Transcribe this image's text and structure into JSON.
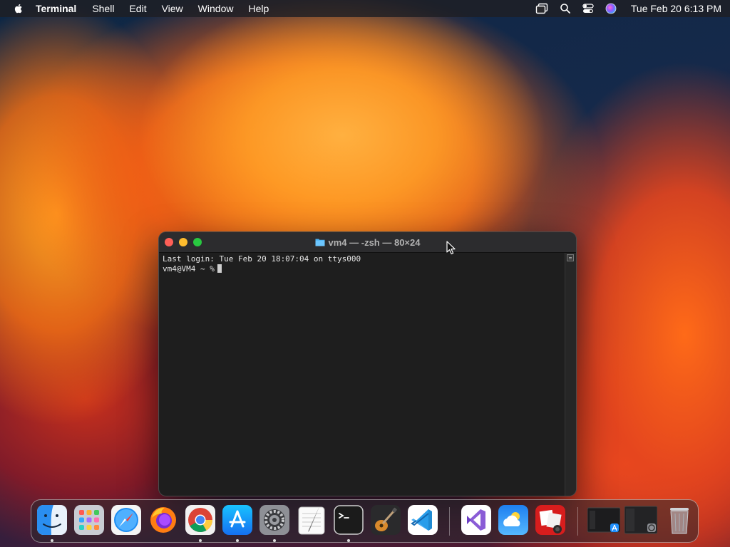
{
  "menubar": {
    "app_name": "Terminal",
    "menus": [
      "Shell",
      "Edit",
      "View",
      "Window",
      "Help"
    ],
    "clock": "Tue Feb 20  6:13 PM",
    "status_icons": [
      "window-stack-icon",
      "search-icon",
      "control-center-icon",
      "siri-icon"
    ]
  },
  "terminal": {
    "title": "vm4 — -zsh — 80×24",
    "lines": [
      "Last login: Tue Feb 20 18:07:04 on ttys000"
    ],
    "prompt": "vm4@VM4 ~ %"
  },
  "dock": {
    "apps": [
      {
        "name": "Finder",
        "icon": "finder-icon",
        "running": true
      },
      {
        "name": "Launchpad",
        "icon": "launchpad-icon",
        "running": false
      },
      {
        "name": "Safari",
        "icon": "safari-icon",
        "running": false
      },
      {
        "name": "Firefox",
        "icon": "firefox-icon",
        "running": false
      },
      {
        "name": "Google Chrome",
        "icon": "chrome-icon",
        "running": true
      },
      {
        "name": "App Store",
        "icon": "app-store-icon",
        "running": true
      },
      {
        "name": "System Settings",
        "icon": "settings-gear-icon",
        "running": true
      },
      {
        "name": "TextEdit",
        "icon": "textedit-icon",
        "running": false
      },
      {
        "name": "Terminal",
        "icon": "terminal-icon",
        "running": true
      },
      {
        "name": "GarageBand",
        "icon": "garageband-guitar-icon",
        "running": false
      },
      {
        "name": "Visual Studio Code",
        "icon": "vscode-icon",
        "running": false
      },
      {
        "name": "Visual Studio",
        "icon": "visual-studio-icon",
        "running": false
      },
      {
        "name": "Weather",
        "icon": "weather-cloud-icon",
        "running": false
      },
      {
        "name": "Photo Booth",
        "icon": "photo-booth-icon",
        "running": false
      },
      {
        "name": "Minimized App Store",
        "icon": "minimized-window-icon",
        "running": false
      },
      {
        "name": "Minimized Settings",
        "icon": "minimized-window-icon",
        "running": false
      },
      {
        "name": "Trash",
        "icon": "trash-icon",
        "running": false
      }
    ]
  },
  "colors": {
    "close": "#ff5f57",
    "minimize": "#febc2e",
    "maximize": "#28c840",
    "terminal_bg": "#1e1e1e"
  }
}
